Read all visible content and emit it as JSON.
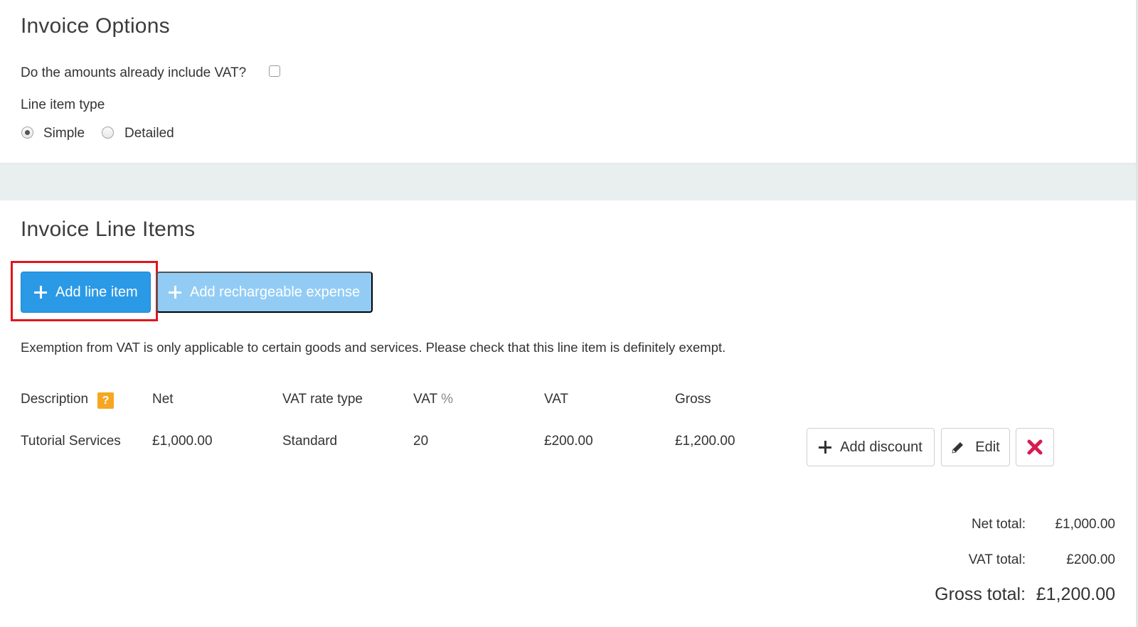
{
  "invoice_options": {
    "title": "Invoice Options",
    "vat_included_question": "Do the amounts already include VAT?",
    "vat_included_checked": false,
    "line_item_type_label": "Line item type",
    "line_item_types": [
      {
        "label": "Simple",
        "selected": true
      },
      {
        "label": "Detailed",
        "selected": false
      }
    ]
  },
  "line_items": {
    "title": "Invoice Line Items",
    "add_line_item_label": "Add line item",
    "add_expense_label": "Add rechargeable expense",
    "exemption_note": "Exemption from VAT is only applicable to certain goods and services. Please check that this line item is definitely exempt.",
    "columns": {
      "description": "Description",
      "net": "Net",
      "vat_rate_type": "VAT rate type",
      "vat_percent_main": "VAT",
      "vat_percent_symbol": "%",
      "vat": "VAT",
      "gross": "Gross"
    },
    "help_glyph": "?",
    "rows": [
      {
        "description": "Tutorial Services",
        "net": "£1,000.00",
        "vat_rate_type": "Standard",
        "vat_percent": "20",
        "vat": "£200.00",
        "gross": "£1,200.00"
      }
    ],
    "row_actions": {
      "add_discount": "Add discount",
      "edit": "Edit"
    }
  },
  "totals": {
    "net_label": "Net total:",
    "net_value": "£1,000.00",
    "vat_label": "VAT total:",
    "vat_value": "£200.00",
    "gross_label": "Gross total:",
    "gross_value": "£1,200.00"
  },
  "colors": {
    "primary": "#2b9ae6",
    "disabled": "#92ccf5",
    "highlight": "#e0161e",
    "help_badge": "#f5a623",
    "delete": "#d81b4f"
  }
}
